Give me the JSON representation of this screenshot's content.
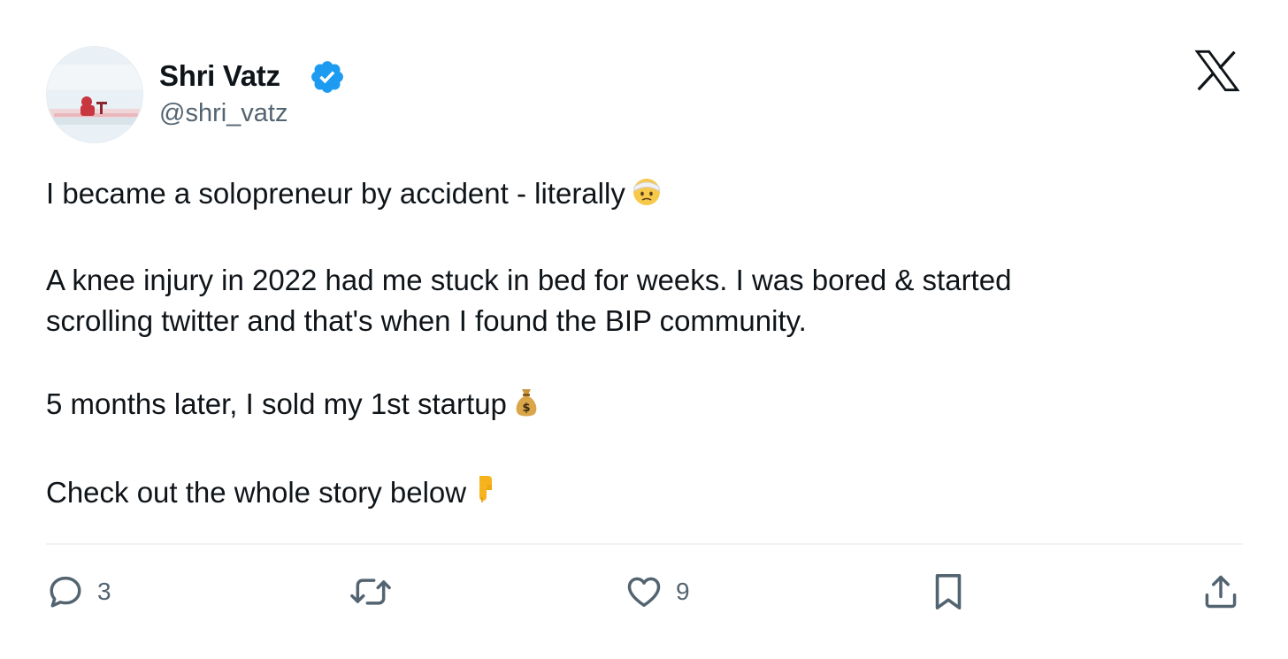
{
  "author": {
    "display_name": "Shri Vatz",
    "handle": "@shri_vatz",
    "verified": true,
    "avatar_icon": "profile-photo-icon"
  },
  "platform": {
    "logo_icon": "x-logo-icon"
  },
  "tweet": {
    "lines": [
      {
        "text": "I became a solopreneur by accident - literally",
        "emoji": "face-with-head-bandage"
      },
      {
        "text": "A knee injury in 2022 had me stuck in bed for weeks. I was bored & started"
      },
      {
        "text": "scrolling twitter and that's when I found the BIP community."
      },
      {
        "text": "5 months later, I sold my 1st startup",
        "emoji": "money-bag"
      },
      {
        "text": "Check out the whole story below",
        "emoji": "backhand-index-pointing-down"
      }
    ]
  },
  "actions": {
    "reply": {
      "icon": "reply-icon",
      "count": "3"
    },
    "retweet": {
      "icon": "retweet-icon",
      "count": ""
    },
    "like": {
      "icon": "heart-icon",
      "count": "9"
    },
    "bookmark": {
      "icon": "bookmark-icon"
    },
    "share": {
      "icon": "share-icon"
    }
  },
  "colors": {
    "text_primary": "#0f1419",
    "text_secondary": "#536471",
    "verified_blue": "#1d9bf0",
    "divider": "#eff3f4"
  }
}
